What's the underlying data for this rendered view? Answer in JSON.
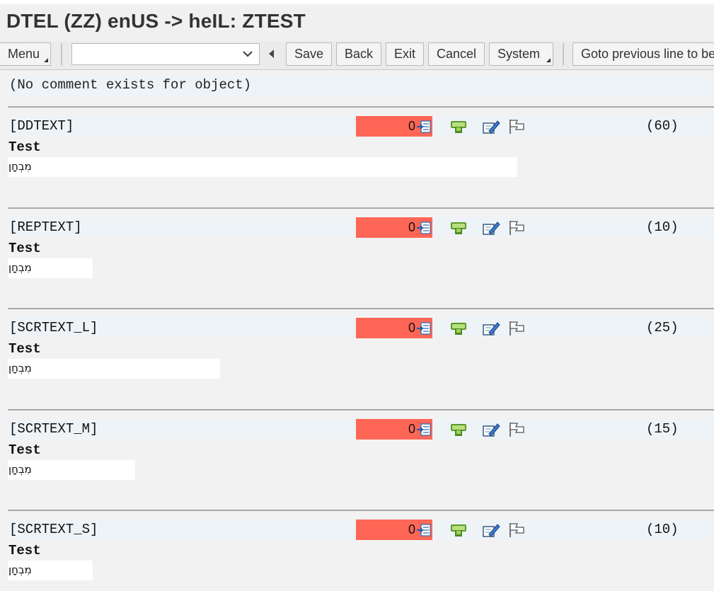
{
  "title": "DTEL (ZZ) enUS -> heIL: ZTEST",
  "toolbar": {
    "menu": "Menu",
    "command_value": "",
    "save": "Save",
    "back": "Back",
    "exit": "Exit",
    "cancel": "Cancel",
    "system": "System",
    "goto_prev": "Goto previous line to be"
  },
  "comment": "(No comment exists for object)",
  "colors": {
    "count_bg": "#ff6656",
    "band_bg": "#eef3f7"
  },
  "icons": [
    "pc-mail-icon",
    "pencil-edit-icon",
    "flag-icon",
    "transfer-list-icon"
  ],
  "sections": [
    {
      "field": "[DDTEXT]",
      "count": "0",
      "maxlen": "(60)",
      "source": "Test",
      "target": "מִבְחָן"
    },
    {
      "field": "[REPTEXT]",
      "count": "0",
      "maxlen": "(10)",
      "source": "Test",
      "target": "מִבְחָן"
    },
    {
      "field": "[SCRTEXT_L]",
      "count": "0",
      "maxlen": "(25)",
      "source": "Test",
      "target": "מִבְחָן"
    },
    {
      "field": "[SCRTEXT_M]",
      "count": "0",
      "maxlen": "(15)",
      "source": "Test",
      "target": "מִבְחָן"
    },
    {
      "field": "[SCRTEXT_S]",
      "count": "0",
      "maxlen": "(10)",
      "source": "Test",
      "target": "מִבְחָן"
    }
  ]
}
